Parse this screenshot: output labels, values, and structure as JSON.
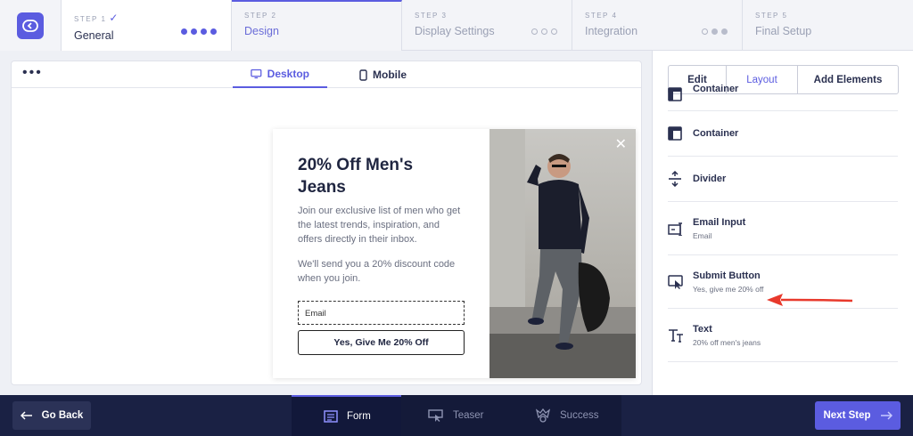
{
  "steps": [
    {
      "label": "STEP 1",
      "check": "✓",
      "name": "General"
    },
    {
      "label": "STEP 2",
      "name": "Design"
    },
    {
      "label": "STEP 3",
      "name": "Display Settings"
    },
    {
      "label": "STEP 4",
      "name": "Integration"
    },
    {
      "label": "STEP 5",
      "name": "Final Setup"
    }
  ],
  "preview": {
    "menu": "•••",
    "tabs": [
      {
        "label": "Desktop"
      },
      {
        "label": "Mobile"
      }
    ],
    "popup": {
      "title": "20% Off Men's Jeans",
      "body1": "Join our exclusive list of men who get the latest trends, inspiration, and offers directly in their inbox.",
      "body2": "We'll send you a 20% discount code when you join.",
      "email_placeholder": "Email",
      "cta": "Yes, Give Me 20% Off",
      "close": "✕"
    }
  },
  "panel": {
    "tabs": [
      {
        "label": "Edit"
      },
      {
        "label": "Layout"
      },
      {
        "label": "Add Elements"
      }
    ],
    "elements": [
      {
        "title": "Container",
        "sub": ""
      },
      {
        "title": "Container",
        "sub": ""
      },
      {
        "title": "Divider",
        "sub": ""
      },
      {
        "title": "Email Input",
        "sub": "Email"
      },
      {
        "title": "Submit Button",
        "sub": "Yes, give me 20% off"
      },
      {
        "title": "Text",
        "sub": "20% off men's jeans"
      }
    ]
  },
  "bottom": {
    "back": "Go Back",
    "nav": [
      {
        "label": "Form"
      },
      {
        "label": "Teaser"
      },
      {
        "label": "Success"
      }
    ],
    "next": "Next Step"
  },
  "colors": {
    "accent": "#5b5ce0",
    "footer": "#1a2144",
    "arrow": "#e8392c"
  }
}
